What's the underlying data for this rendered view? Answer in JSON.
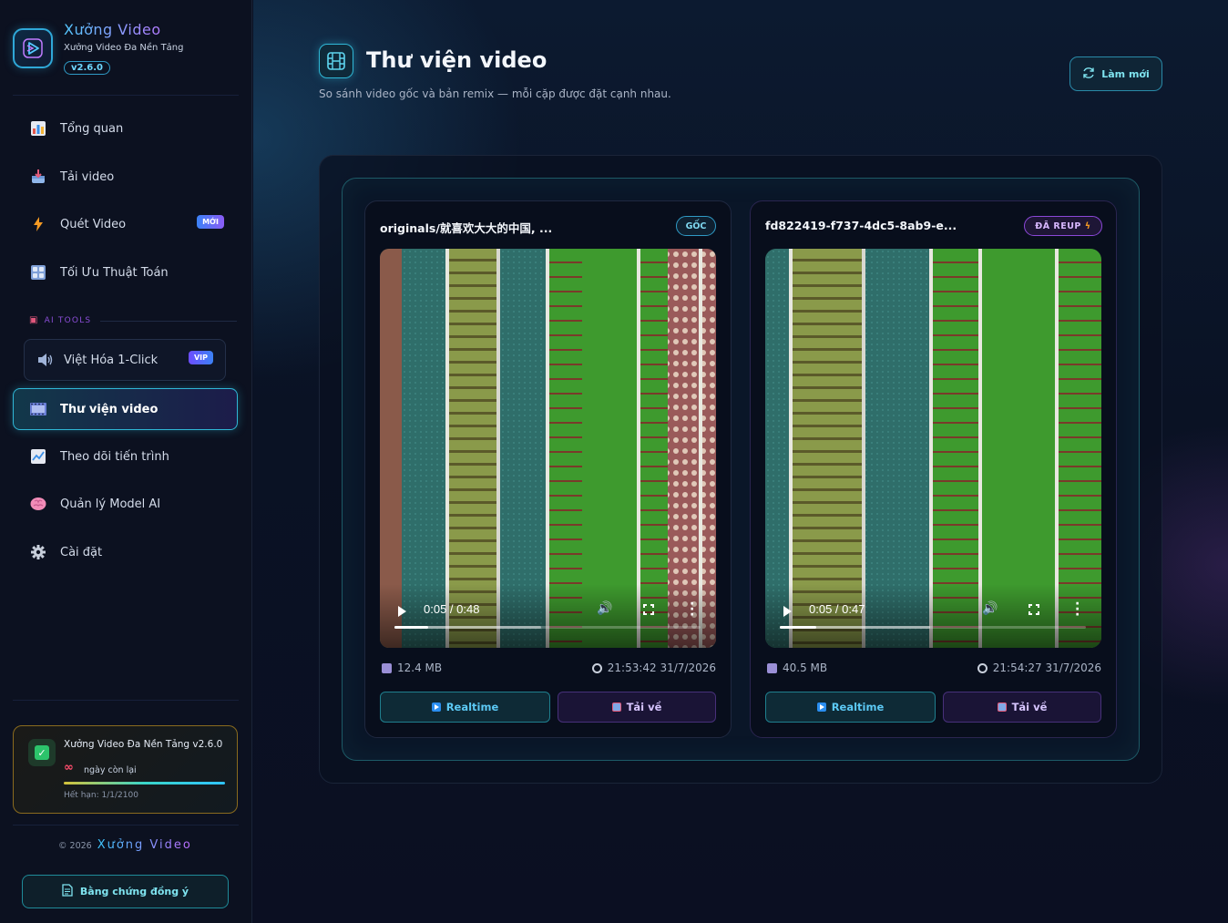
{
  "brand": {
    "title": "Xưởng Video",
    "subtitle": "Xưởng Video Đa Nền Tảng",
    "version": "v2.6.0"
  },
  "nav": {
    "items": [
      {
        "label": "Tổng quan",
        "icon": "bar-chart-icon"
      },
      {
        "label": "Tải video",
        "icon": "download-tray-icon"
      },
      {
        "label": "Quét Video",
        "icon": "lightning-icon",
        "badge": "MỚI"
      },
      {
        "label": "Tối Ưu Thuật Toán",
        "icon": "grid-icon"
      },
      {
        "label": "Việt Hóa 1-Click",
        "icon": "speaker-icon",
        "badge": "VIP"
      },
      {
        "label": "Thư viện video",
        "icon": "film-icon",
        "active": true
      },
      {
        "label": "Theo dõi tiến trình",
        "icon": "line-chart-icon"
      },
      {
        "label": "Quản lý Model AI",
        "icon": "brain-icon"
      },
      {
        "label": "Cài đặt",
        "icon": "gear-icon"
      }
    ],
    "ai_tools_label": "AI TOOLS"
  },
  "license": {
    "title": "Xưởng Video Đa Nền Tảng v2.6.0",
    "days_symbol": "∞",
    "days_label": "ngày còn lại",
    "expiry": "Hết hạn: 1/1/2100"
  },
  "footer": {
    "copyright": "© 2026",
    "brand": "Xưởng Video",
    "agreement_label": "Bằng chứng đồng ý"
  },
  "page": {
    "title": "Thư viện video",
    "subtitle": "So sánh video gốc và bản remix — mỗi cặp được đặt cạnh nhau.",
    "refresh_label": "Làm mới"
  },
  "videos": [
    {
      "title": "originals/就喜欢大大的中国, ...",
      "tag": "GỐC",
      "time_display": "0:05 / 0:48",
      "progress": 0.11,
      "buffered": 0.48,
      "size": "12.4 MB",
      "timestamp": "21:53:42 31/7/2026",
      "realtime_label": "Realtime",
      "download_label": "Tải về"
    },
    {
      "title": "fd822419-f737-4dc5-8ab9-e...",
      "tag": "ĐÃ REUP",
      "time_display": "0:05 / 0:47",
      "progress": 0.12,
      "buffered": 0.49,
      "size": "40.5 MB",
      "timestamp": "21:54:27 31/7/2026",
      "realtime_label": "Realtime",
      "download_label": "Tải về"
    }
  ],
  "colors": {
    "accent": "#2fb7d6",
    "brand_gradient_start": "#54c8ff",
    "brand_gradient_end": "#b27bff",
    "reup_accent": "#8b47d8"
  }
}
